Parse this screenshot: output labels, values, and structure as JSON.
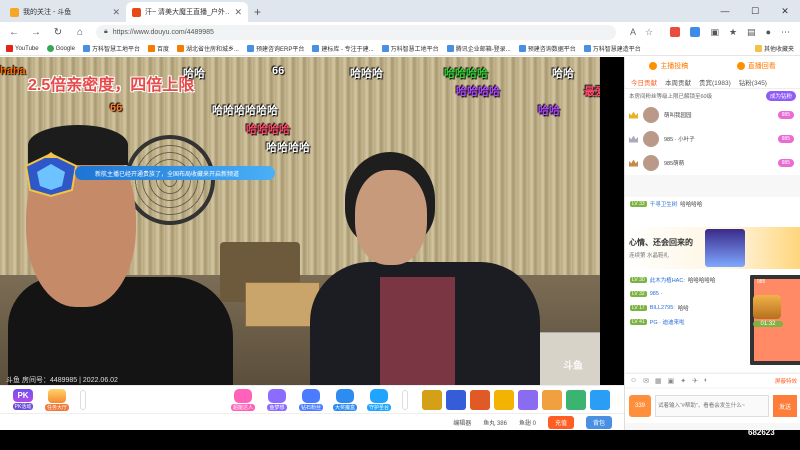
{
  "browser": {
    "tabs": [
      {
        "title": "我的关注 - 斗鱼",
        "active": false
      },
      {
        "title": "汗~ 清美大魔王直播_户外…",
        "active": true
      }
    ],
    "url": "https://www.douyu.com/4489985",
    "window_controls": [
      "—",
      "☐",
      "✕"
    ]
  },
  "bookmarks": {
    "items": [
      {
        "label": "YouTube",
        "icon": "youtube-icon"
      },
      {
        "label": "Google",
        "icon": "google-icon"
      },
      {
        "label": "万科智慧工地平台",
        "icon": "site-icon"
      },
      {
        "label": "百度",
        "icon": "baidu-icon"
      },
      {
        "label": "湖北省住房和城乡...",
        "icon": "site-icon"
      },
      {
        "label": "预建咨询ERP平台",
        "icon": "site-icon"
      },
      {
        "label": "建标库 - 专注于建...",
        "icon": "site-icon"
      },
      {
        "label": "万科智慧工地平台",
        "icon": "site-icon"
      },
      {
        "label": "腾讯企业邮箱-登录...",
        "icon": "site-icon"
      },
      {
        "label": "预建咨询数据平台",
        "icon": "site-icon"
      },
      {
        "label": "万科智慧建造平台",
        "icon": "site-icon"
      }
    ],
    "other": "其他收藏夹"
  },
  "stream": {
    "promo_text": "2.5倍亲密度，四倍上限",
    "noble_banner": "新航主播已经开通贵族了，全国布局收藏来开启新频道",
    "room_watermark": "斗鱼 房间号：4489985 | 2022.06.02",
    "logo_watermark": "斗鱼",
    "danmu": [
      {
        "text": "haha",
        "color": "#ff6a00"
      },
      {
        "text": "哈哈",
        "color": "#ffffff"
      },
      {
        "text": "66",
        "color": "#ffffff"
      },
      {
        "text": "哈哈哈",
        "color": "#ffffff"
      },
      {
        "text": "哈哈哈哈",
        "color": "#3ad13a"
      },
      {
        "text": "哈哈",
        "color": "#ffffff"
      },
      {
        "text": "66",
        "color": "#ff7e2e"
      },
      {
        "text": "哈哈哈哈哈哈",
        "color": "#ffffff"
      },
      {
        "text": "哈哈哈哈",
        "color": "#b24cff"
      },
      {
        "text": "哈哈",
        "color": "#b24cff"
      },
      {
        "text": "哈哈哈哈",
        "color": "#ff4d6d"
      },
      {
        "text": "哈哈哈哈",
        "color": "#ffffff"
      },
      {
        "text": "最爱",
        "color": "#ff4d6d"
      }
    ]
  },
  "giftbar": {
    "pk": {
      "icon": "PK",
      "label": "PK活动"
    },
    "task": {
      "label": "任务大厅"
    },
    "features": [
      {
        "label": "超能达人",
        "color": "#ff62b8"
      },
      {
        "label": "鱼梦想",
        "color": "#8c6cff"
      },
      {
        "label": "钻石粉丝",
        "color": "#4b7cff"
      },
      {
        "label": "大奖魔盒",
        "color": "#2d8cf0"
      },
      {
        "label": "守护圣台",
        "color": "#1fa5ff"
      }
    ],
    "gifts": [
      "#d4a017",
      "#355dd8",
      "#e05a28",
      "#f2b400",
      "#8b6cf0",
      "#f0a040",
      "#3cb371",
      "#2a9df4"
    ]
  },
  "statusbar": {
    "items": [
      "编辑器",
      "鱼丸 386",
      "鱼翅 0"
    ],
    "recharge": "充值",
    "backpack": "背包"
  },
  "sidebar": {
    "top": [
      {
        "label": "主播投稿",
        "icon": "trophy-icon"
      },
      {
        "label": "直播回看",
        "icon": "replay-icon"
      }
    ],
    "tabs": [
      "今日贡献",
      "本周贡献",
      "贵宾(1983)",
      "钻粉(345)"
    ],
    "active_tab": 0,
    "notice": "本房间粉丝等级上限已解锁至60级",
    "notice_button": "成为钻粉",
    "ranks": [
      {
        "name": "萌叫我园园",
        "level": "985"
      },
      {
        "name": "985 · 小叶子",
        "level": "985"
      },
      {
        "name": "985萌萌",
        "level": "985"
      }
    ],
    "fan_banner": {
      "title": "心情、还会回来的",
      "sub": "连续第 水晶鞋礼"
    },
    "chat": [
      {
        "lv": "LV 33",
        "fan": "985",
        "user": "千寻卫生树",
        "txt": "哈哈哈哈"
      },
      {
        "lv": "LV 30",
        "fan": "985",
        "user": "此木为植HAC:",
        "txt": "哈哈哈哈哈"
      },
      {
        "lv": "LV 32",
        "fan": "985",
        "user": "985 ·",
        "txt": ""
      },
      {
        "lv": "LV 17",
        "fan": "",
        "user": "BILL2795:",
        "txt": "哈哈"
      },
      {
        "lv": "LV 41",
        "fan": "985",
        "user": "PG · 迪迪来啦",
        "txt": ""
      }
    ],
    "chest_timer": "01:32",
    "chat_tools": [
      "☺",
      "✉",
      "▦",
      "▣",
      "✦",
      "✈",
      "◐"
    ],
    "shield_label": "屏蔽特效",
    "input_placeholder": "试着输入“#帮助”，看看会发生什么~",
    "gift_icon_label": "339",
    "send_label": "发送"
  },
  "room_number": "682623"
}
